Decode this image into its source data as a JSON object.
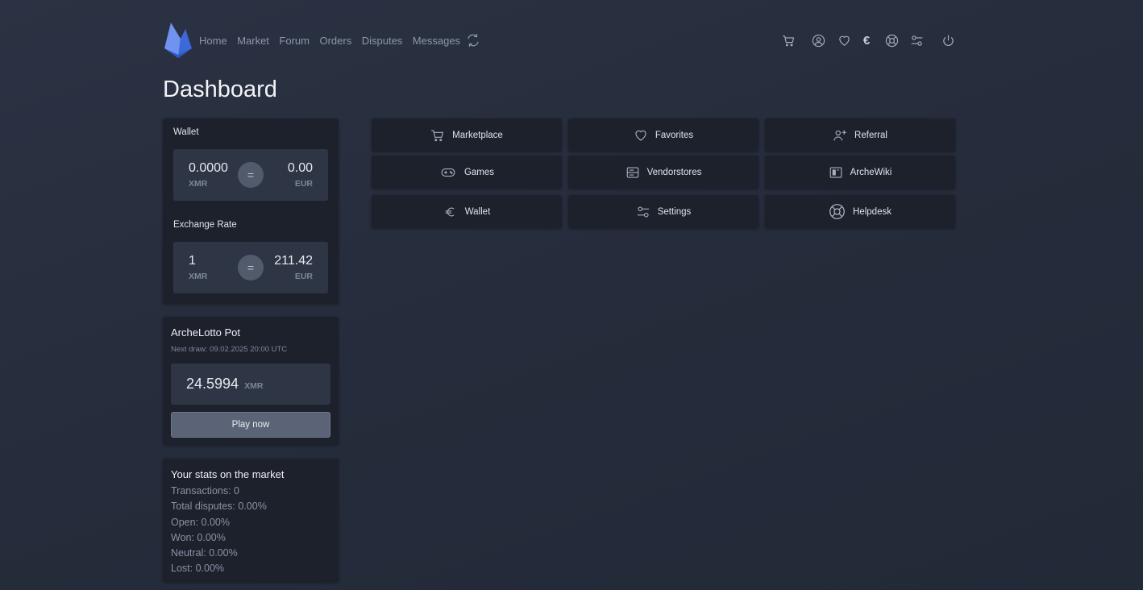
{
  "nav": {
    "links": [
      "Home",
      "Market",
      "Forum",
      "Orders",
      "Disputes",
      "Messages"
    ],
    "icons": [
      "cart-icon",
      "user-icon",
      "heart-icon",
      "euro-icon",
      "lifebuoy-icon",
      "settings-sliders-icon",
      "power-icon"
    ],
    "euro_symbol": "€",
    "accent": "#4f7ce8"
  },
  "page_title": "Dashboard",
  "wallet": {
    "label": "Wallet",
    "xmr_value": "0.0000",
    "xmr_unit": "XMR",
    "eur_value": "0.00",
    "eur_unit": "EUR",
    "equals": "="
  },
  "exchange": {
    "label": "Exchange Rate",
    "xmr_value": "1",
    "xmr_unit": "XMR",
    "eur_value": "211.42",
    "eur_unit": "EUR",
    "equals": "="
  },
  "lotto": {
    "title": "ArcheLotto Pot",
    "next_draw": "Next draw: 09.02.2025 20:00 UTC",
    "value": "24.5994",
    "unit": "XMR",
    "button": "Play now"
  },
  "stats": {
    "title": "Your stats on the market",
    "rows": [
      "Transactions: 0",
      "Total disputes: 0.00%",
      "Open: 0.00%",
      "Won: 0.00%",
      "Neutral: 0.00%",
      "Lost: 0.00%"
    ]
  },
  "tiles": [
    {
      "label": "Marketplace",
      "icon": "cart-icon"
    },
    {
      "label": "Favorites",
      "icon": "heart-icon"
    },
    {
      "label": "Referral",
      "icon": "user-plus-icon"
    },
    {
      "label": "Games",
      "icon": "gamepad-icon"
    },
    {
      "label": "Vendorstores",
      "icon": "server-icon"
    },
    {
      "label": "ArcheWiki",
      "icon": "wiki-icon"
    },
    {
      "label": "Wallet",
      "icon": "euro-icon"
    },
    {
      "label": "Settings",
      "icon": "settings-sliders-icon"
    },
    {
      "label": "Helpdesk",
      "icon": "lifebuoy-icon"
    }
  ]
}
